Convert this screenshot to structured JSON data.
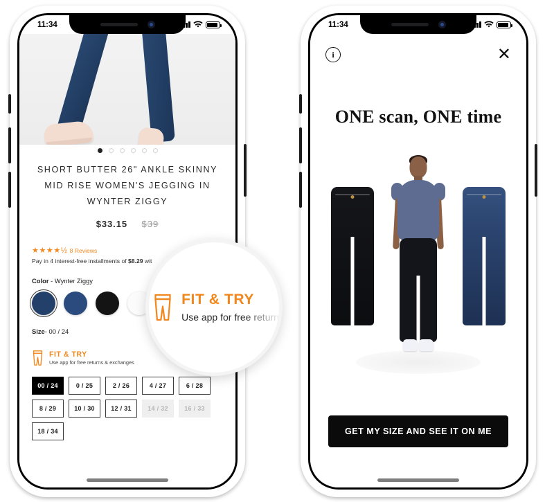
{
  "phones": {
    "left": {
      "status_bar": {
        "time": "11:34",
        "signal_icon": "cellular-bars-icon",
        "wifi_icon": "wifi-icon",
        "battery_icon": "battery-icon"
      },
      "hero": {
        "alt": "product-photo-legs-in-jeans",
        "carousel_dots": 6,
        "active_dot": 1
      },
      "product": {
        "title": "SHORT BUTTER 26\" ANKLE SKINNY MID RISE WOMEN'S JEGGING IN WYNTER ZIGGY",
        "price": "$33.15",
        "compare_price": "$39",
        "stars": "★★★★",
        "half_star": "★",
        "reviews": "8 Reviews",
        "installment_prefix": "Pay in 4 interest-free installments of ",
        "installment_amount": "$8.29",
        "installment_suffix": " wit"
      },
      "color": {
        "label": "Color",
        "value": "- Wynter Ziggy",
        "swatches": [
          {
            "name": "wynter-ziggy",
            "hex": "#22406a",
            "selected": true
          },
          {
            "name": "medium-blue",
            "hex": "#2b4a7e",
            "selected": false
          },
          {
            "name": "black",
            "hex": "#141414",
            "selected": false
          },
          {
            "name": "white",
            "hex": "#fbfbfb",
            "selected": false
          }
        ]
      },
      "size": {
        "label": "Size",
        "value": "- 00 / 24"
      },
      "fit_try": {
        "title": "FIT & TRY",
        "subtitle": "Use app for free returns & exchanges",
        "icon": "pants-icon",
        "color": "#f1881f"
      },
      "sizes": [
        {
          "label": "00 / 24",
          "state": "selected"
        },
        {
          "label": "0 / 25",
          "state": "available"
        },
        {
          "label": "2 / 26",
          "state": "available"
        },
        {
          "label": "4 / 27",
          "state": "available"
        },
        {
          "label": "6 / 28",
          "state": "available"
        },
        {
          "label": "8 / 29",
          "state": "available"
        },
        {
          "label": "10 / 30",
          "state": "available"
        },
        {
          "label": "12 / 31",
          "state": "available"
        },
        {
          "label": "14 / 32",
          "state": "disabled"
        },
        {
          "label": "16 / 33",
          "state": "disabled"
        },
        {
          "label": "18 / 34",
          "state": "available"
        }
      ]
    },
    "right": {
      "status_bar": {
        "time": "11:34",
        "signal_icon": "cellular-bars-icon",
        "wifi_icon": "wifi-icon",
        "battery_icon": "battery-icon"
      },
      "topbar": {
        "info_icon": "info-icon",
        "info_glyph": "i",
        "close_icon": "close-icon",
        "close_glyph": "✕"
      },
      "headline": "ONE scan, ONE time",
      "scene": {
        "avatar_alt": "avatar-model-wearing-black-jeans",
        "left_garment_alt": "black-skinny-jeans",
        "right_garment_alt": "dark-blue-skinny-jeans"
      },
      "cta_label": "GET MY SIZE AND SEE IT ON ME"
    }
  },
  "magnifier": {
    "title": "FIT & TRY",
    "subtitle": "Use app for free returns",
    "icon": "pants-icon",
    "color": "#f1881f"
  }
}
